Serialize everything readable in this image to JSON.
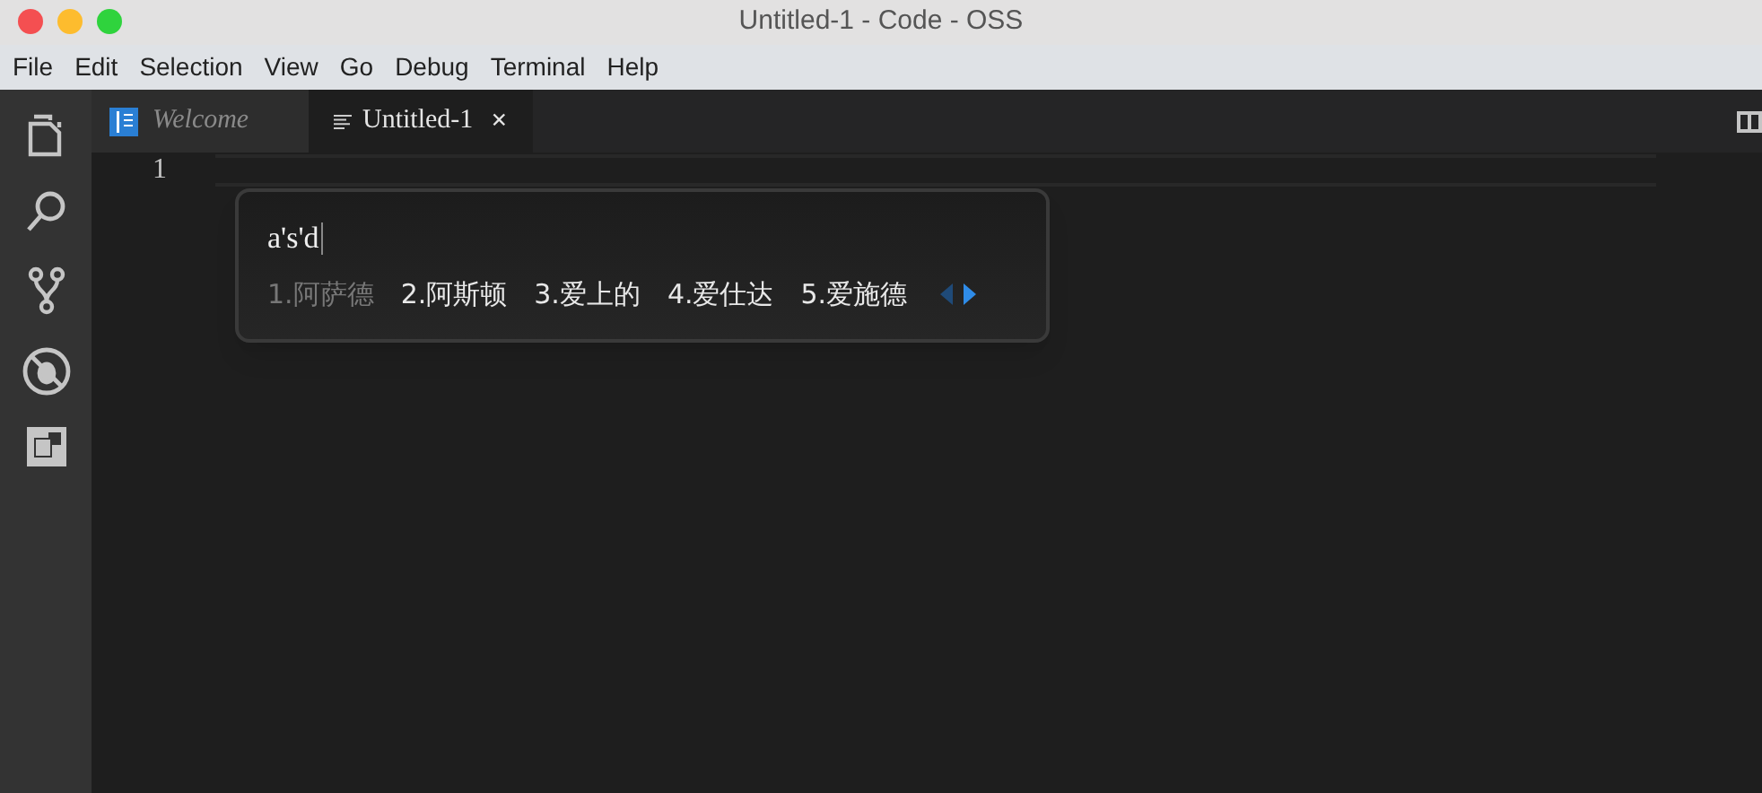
{
  "window": {
    "title": "Untitled-1 - Code - OSS"
  },
  "menu": [
    "File",
    "Edit",
    "Selection",
    "View",
    "Go",
    "Debug",
    "Terminal",
    "Help"
  ],
  "tabs": [
    {
      "label": "Welcome",
      "selected": false
    },
    {
      "label": "Untitled-1",
      "selected": true,
      "close": "×"
    }
  ],
  "editor": {
    "line_numbers": [
      "1"
    ]
  },
  "ime": {
    "input": "a's'd",
    "candidates": [
      {
        "label": "1.阿萨德",
        "selected": true
      },
      {
        "label": "2.阿斯顿",
        "selected": false
      },
      {
        "label": "3.爱上的",
        "selected": false
      },
      {
        "label": "4.爱仕达",
        "selected": false
      },
      {
        "label": "5.爱施德",
        "selected": false
      }
    ],
    "prev_disabled": true,
    "next_disabled": false
  }
}
